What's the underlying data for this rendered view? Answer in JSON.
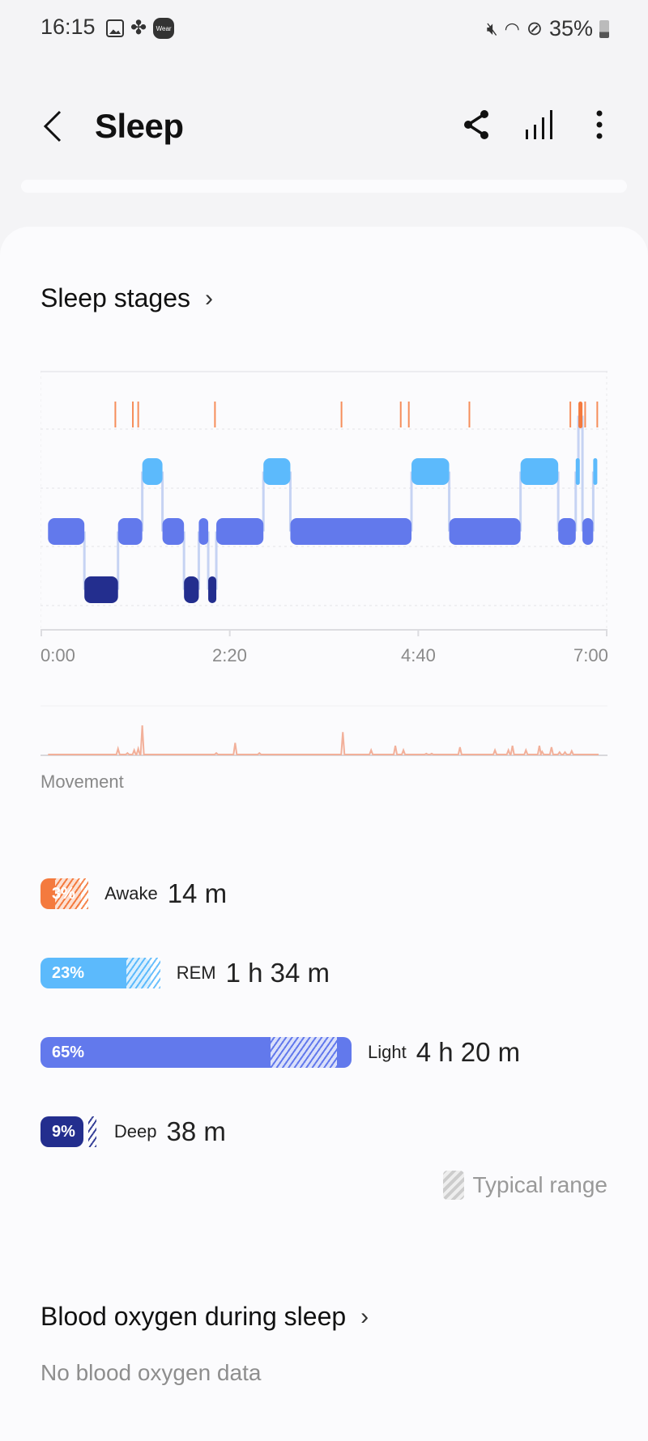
{
  "status_bar": {
    "time": "16:15",
    "left_icons": [
      "gallery-icon",
      "fan-icon",
      "wear-icon"
    ],
    "wear_label": "Wear",
    "right_icons": [
      "mute-icon",
      "wifi-icon",
      "do-not-disturb-icon",
      "battery-icon"
    ],
    "battery": "35%"
  },
  "app_bar": {
    "title": "Sleep",
    "actions": [
      "share-icon",
      "chart-icon",
      "more-icon"
    ]
  },
  "sleep_stages": {
    "heading": "Sleep stages",
    "colors": {
      "Awake": "#f47a3e",
      "REM": "#5cbafc",
      "Light": "#6279ec",
      "Deep": "#232e8e"
    },
    "axis_ticks": [
      "0:00",
      "2:20",
      "4:40",
      "7:00"
    ],
    "movement_label": "Movement",
    "stages": [
      {
        "name": "Awake",
        "percent_label": "3%",
        "percent": 3,
        "duration": "14 m",
        "typical_range": [
          3,
          10
        ]
      },
      {
        "name": "REM",
        "percent_label": "23%",
        "percent": 23,
        "duration": "1 h 34 m",
        "typical_range": [
          18,
          25
        ]
      },
      {
        "name": "Light",
        "percent_label": "65%",
        "percent": 65,
        "duration": "4 h 20 m",
        "typical_range": [
          48,
          62
        ]
      },
      {
        "name": "Deep",
        "percent_label": "9%",
        "percent": 9,
        "duration": "38 m",
        "typical_range": [
          9,
          12
        ]
      }
    ],
    "legend_label": "Typical range"
  },
  "chart_data": {
    "type": "hypnogram",
    "title": "Sleep stages",
    "xlabel": "",
    "x_range_minutes": [
      0,
      420
    ],
    "x_ticks": [
      "0:00",
      "2:20",
      "4:40",
      "7:00"
    ],
    "levels": [
      "Awake",
      "REM",
      "Light",
      "Deep"
    ],
    "segments": [
      {
        "stage": "Light",
        "start": 5,
        "end": 32
      },
      {
        "stage": "Deep",
        "start": 32,
        "end": 57
      },
      {
        "stage": "Light",
        "start": 57,
        "end": 75
      },
      {
        "stage": "REM",
        "start": 75,
        "end": 90
      },
      {
        "stage": "Light",
        "start": 90,
        "end": 106
      },
      {
        "stage": "Deep",
        "start": 106,
        "end": 117
      },
      {
        "stage": "Light",
        "start": 117,
        "end": 124
      },
      {
        "stage": "Deep",
        "start": 124,
        "end": 130
      },
      {
        "stage": "Light",
        "start": 130,
        "end": 165
      },
      {
        "stage": "REM",
        "start": 165,
        "end": 185
      },
      {
        "stage": "Light",
        "start": 185,
        "end": 275
      },
      {
        "stage": "REM",
        "start": 275,
        "end": 303
      },
      {
        "stage": "Light",
        "start": 303,
        "end": 356
      },
      {
        "stage": "REM",
        "start": 356,
        "end": 384
      },
      {
        "stage": "Light",
        "start": 384,
        "end": 397
      },
      {
        "stage": "REM",
        "start": 397,
        "end": 399
      },
      {
        "stage": "Awake",
        "start": 399,
        "end": 402
      },
      {
        "stage": "Light",
        "start": 402,
        "end": 410
      },
      {
        "stage": "REM",
        "start": 410,
        "end": 413
      }
    ],
    "awake_ticks": [
      55,
      68,
      72,
      129,
      223,
      267,
      273,
      318,
      393,
      404,
      413
    ],
    "movement": {
      "label": "Movement",
      "peaks": [
        [
          57,
          0.2
        ],
        [
          64,
          0.05
        ],
        [
          69,
          0.15
        ],
        [
          72,
          0.2
        ],
        [
          75,
          1.0
        ],
        [
          130,
          0.05
        ],
        [
          144,
          0.4
        ],
        [
          162,
          0.05
        ],
        [
          224,
          0.77
        ],
        [
          245,
          0.15
        ],
        [
          263,
          0.3
        ],
        [
          269,
          0.15
        ],
        [
          286,
          0.03
        ],
        [
          290,
          0.03
        ],
        [
          311,
          0.25
        ],
        [
          337,
          0.15
        ],
        [
          347,
          0.15
        ],
        [
          350,
          0.3
        ],
        [
          360,
          0.15
        ],
        [
          370,
          0.3
        ],
        [
          372,
          0.1
        ],
        [
          379,
          0.25
        ],
        [
          385,
          0.08
        ],
        [
          389,
          0.08
        ],
        [
          394,
          0.12
        ]
      ]
    }
  },
  "blood_oxygen": {
    "heading": "Blood oxygen during sleep",
    "message": "No blood oxygen data"
  }
}
